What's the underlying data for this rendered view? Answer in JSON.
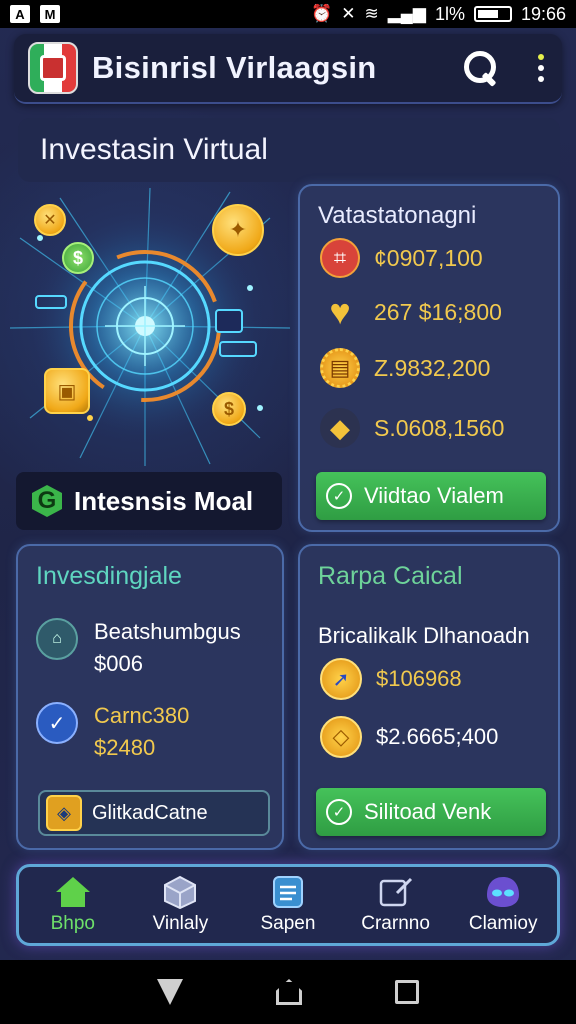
{
  "status_bar": {
    "left_badges": [
      "A",
      "M"
    ],
    "battery_text": "1l%",
    "time": "19:66"
  },
  "app_bar": {
    "title": "Bisinrisl Virlaagsin"
  },
  "hero": {
    "title": "Investasin Virtual"
  },
  "feature": {
    "label": "Intesnsis Moal"
  },
  "stats_card": {
    "title": "Vatastatonagni",
    "rows": [
      {
        "icon": "chart-icon",
        "value": "¢0907,100",
        "color": "#e0473a"
      },
      {
        "icon": "heart-icon",
        "value": "267 $16;800",
        "color": "#f3c23a"
      },
      {
        "icon": "badge-icon",
        "value": "Z.9832,200",
        "color": "#f0a818"
      },
      {
        "icon": "box-icon",
        "value": "S.0608,1560",
        "color": "#f3c23a"
      }
    ],
    "button_label": "Viidtao Vialem"
  },
  "invest_card": {
    "title": "Invesdingjale",
    "item1": {
      "name": "Beatshumbgus",
      "value": "$006"
    },
    "item2": {
      "name": "Carnc380",
      "value": "$2480"
    },
    "button_label": "GlitkadCatne"
  },
  "rapid_card": {
    "title": "Rarpa Caical",
    "subtitle": "Bricalikalk Dlhanoadn",
    "rows": [
      {
        "icon": "rocket-icon",
        "value": "$106968"
      },
      {
        "icon": "diamond-icon",
        "value": "$2.6665;400"
      }
    ],
    "button_label": "Silitoad Venk"
  },
  "bottom_nav": {
    "items": [
      {
        "label": "Bhpo",
        "icon": "home-icon",
        "active": true
      },
      {
        "label": "Vinlaly",
        "icon": "cube-icon",
        "active": false
      },
      {
        "label": "Sapen",
        "icon": "list-icon",
        "active": false
      },
      {
        "label": "Crarnno",
        "icon": "edit-icon",
        "active": false
      },
      {
        "label": "Clamioy",
        "icon": "alien-icon",
        "active": false
      }
    ]
  },
  "colors": {
    "accent_green": "#3bb54a",
    "gold": "#f1c94e",
    "teal": "#5fd6c0",
    "card_border": "#4b6aa8"
  }
}
